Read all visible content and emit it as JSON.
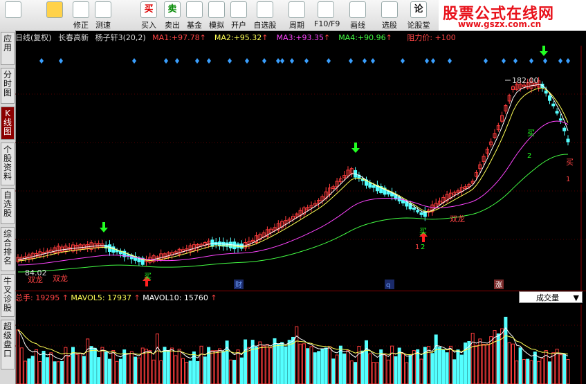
{
  "toolbar": {
    "buttons": [
      {
        "label": "",
        "icon": "home-icon"
      },
      {
        "label": "",
        "icon": "back-arrow-icon"
      },
      {
        "label": "修正",
        "icon": "up-down-icon"
      },
      {
        "label": "测速",
        "icon": "speed-icon"
      },
      {
        "label": "买入",
        "icon": "buy-icon",
        "glyph": "买"
      },
      {
        "label": "卖出",
        "icon": "sell-icon",
        "glyph": "卖"
      },
      {
        "label": "基金",
        "icon": "fund-icon"
      },
      {
        "label": "模拟",
        "icon": "hammer-icon"
      },
      {
        "label": "开户",
        "icon": "lock-icon"
      },
      {
        "label": "自选股",
        "icon": "favorites-icon"
      },
      {
        "label": "周期",
        "icon": "clock-icon"
      },
      {
        "label": "F10/F9",
        "icon": "f10-icon"
      },
      {
        "label": "画线",
        "icon": "pen-icon"
      },
      {
        "label": "选股",
        "icon": "select-stock-icon"
      },
      {
        "label": "论股堂",
        "icon": "forum-icon",
        "glyph": "论"
      }
    ]
  },
  "watermark": {
    "title": "股票公式在线网",
    "url": "www.gszx.com.cn"
  },
  "sidebar": {
    "tabs": [
      {
        "label": "应用"
      },
      {
        "label": "分时图"
      },
      {
        "label": "K线图",
        "active": true
      },
      {
        "label": "个股资料"
      },
      {
        "label": "自选股"
      },
      {
        "label": "综合排名"
      },
      {
        "label": "牛叉诊股"
      },
      {
        "label": "超级盘口"
      }
    ]
  },
  "chart_header": {
    "period": "日线(复权)",
    "stock": "长春高新",
    "indicator": "杨子轩3(20,2)",
    "ma": [
      {
        "name": "MA1",
        "value": "+97.78",
        "color": "#ff4444"
      },
      {
        "name": "MA2",
        "value": "+95.32",
        "color": "#ffff55"
      },
      {
        "name": "MA3",
        "value": "+93.35",
        "color": "#ff44ff"
      },
      {
        "name": "MA4",
        "value": "+90.96",
        "color": "#44ff44"
      }
    ],
    "extra": "阻力价: +100"
  },
  "chart_data": {
    "type": "candlestick",
    "annotations": {
      "high_label": "182.00",
      "low_label": "84.02",
      "signals": [
        {
          "text": "买",
          "kind": "buy"
        },
        {
          "text": "买",
          "kind": "buy"
        },
        {
          "text": "买",
          "kind": "buy"
        },
        {
          "text": "买",
          "kind": "sell"
        },
        {
          "text": "双龙"
        },
        {
          "text": "双龙"
        },
        {
          "text": "双龙"
        },
        {
          "text": "2"
        },
        {
          "text": "1"
        },
        {
          "text": "2"
        },
        {
          "text": "1"
        }
      ],
      "events": [
        "财",
        "q",
        "涨"
      ]
    }
  },
  "volume": {
    "label": "总手",
    "value": "19295",
    "mavol5_label": "MAVOL5",
    "mavol5": "17937",
    "mavol10_label": "MAVOL10",
    "mavol10": "15760",
    "selector": "成交量"
  },
  "colors": {
    "up": "#ff3c3c",
    "down": "#54ffff",
    "accent": "#e8121b"
  }
}
